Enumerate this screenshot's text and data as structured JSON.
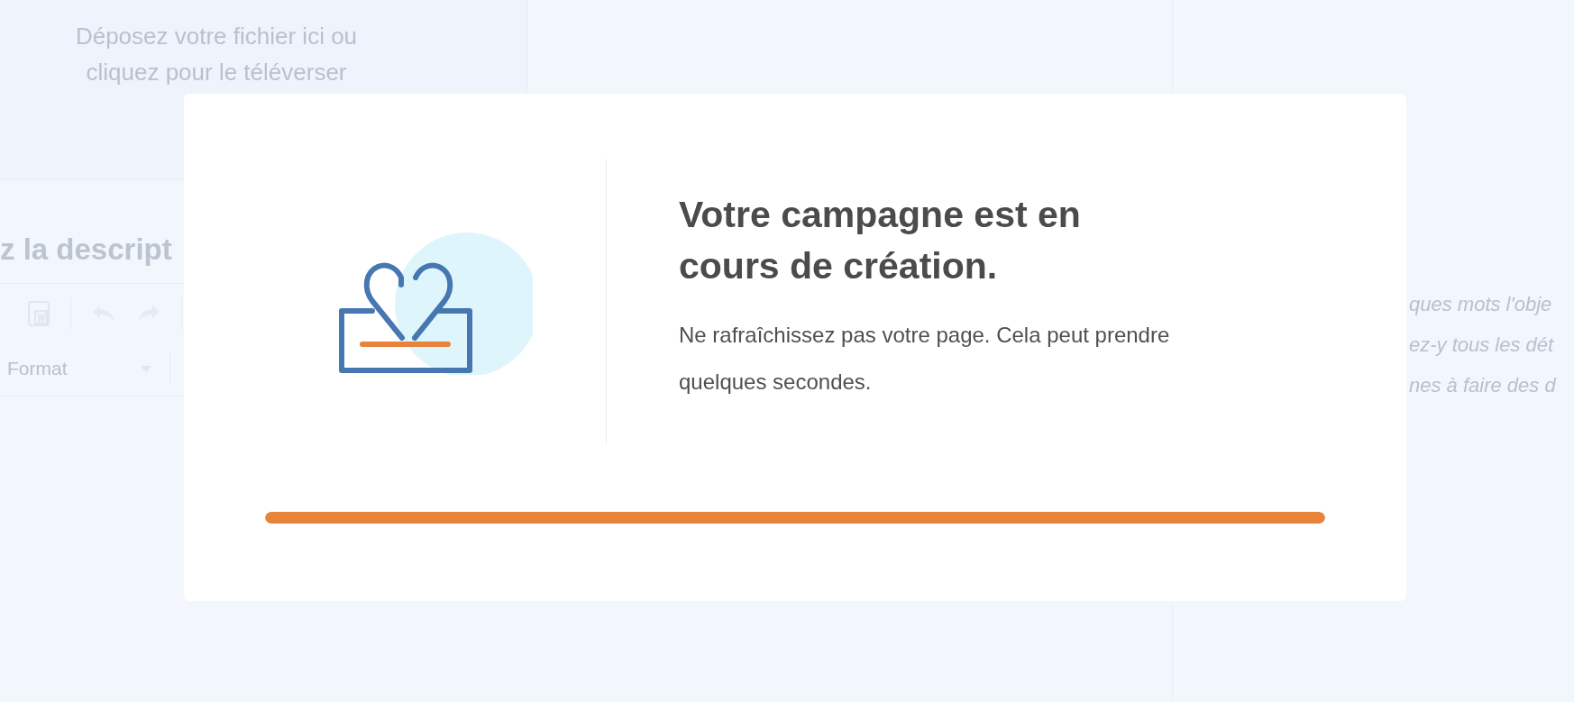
{
  "upload_zone": {
    "text": "Déposez votre fichier ici ou cliquez pour le téléverser"
  },
  "description": {
    "heading": "z la descript",
    "format_select": "Format"
  },
  "side_hint": {
    "lines": [
      "ques mots l'obje",
      "ez-y tous les dét",
      "nes à faire des d"
    ]
  },
  "modal": {
    "heading": "Votre campagne est en cours de création.",
    "message": "Ne rafraîchissez pas votre page. Cela peut prendre quelques secondes.",
    "progress": {
      "level": 1
    }
  }
}
